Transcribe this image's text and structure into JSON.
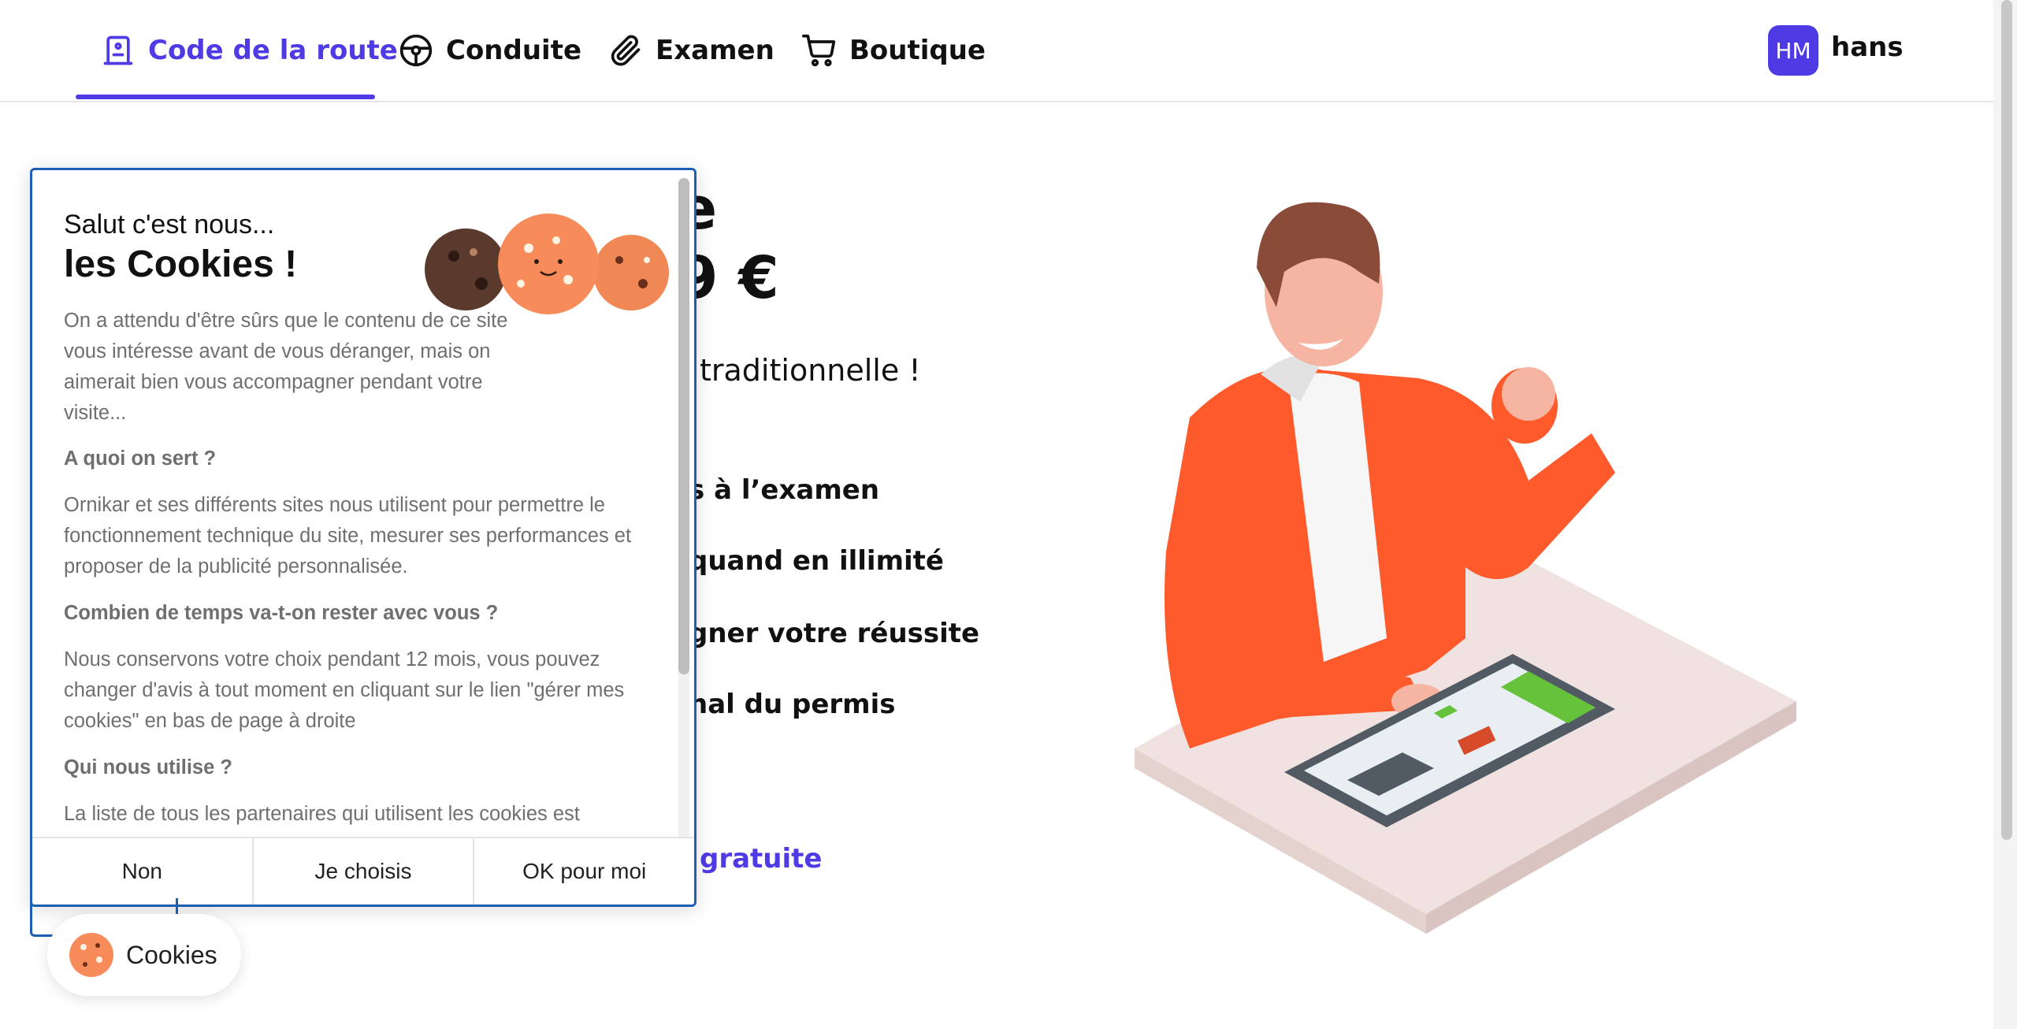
{
  "nav": {
    "items": [
      {
        "label": "Code de la route",
        "icon": "exam-board-icon",
        "active": true
      },
      {
        "label": "Conduite",
        "icon": "steering-wheel-icon",
        "active": false
      },
      {
        "label": "Examen",
        "icon": "paperclip-icon",
        "active": false
      },
      {
        "label": "Boutique",
        "icon": "cart-icon",
        "active": false
      }
    ],
    "user": {
      "initials": "HM",
      "name": "hans"
    }
  },
  "hero": {
    "title_line1_visible": "e",
    "title_line2_visible": "9 €",
    "subtitle_visible": "traditionnelle !",
    "features_visible": [
      "s à l’examen",
      "quand en illimité",
      "gner votre réussite",
      "nal du permis"
    ],
    "cta_visible": "gratuite"
  },
  "cookie_banner": {
    "greeting": "Salut c'est nous...",
    "title": "les Cookies !",
    "intro": "On a attendu d'être sûrs que le contenu de ce site vous intéresse avant de vous déranger, mais on aimerait bien vous accompagner pendant votre visite...",
    "sections": [
      {
        "heading": "A quoi on sert ?",
        "text": "Ornikar et ses différents sites nous utilisent pour permettre le fonctionnement technique du site, mesurer ses performances et proposer de la publicité personnalisée."
      },
      {
        "heading": "Combien de temps va-t-on rester avec vous ?",
        "text": "Nous conservons votre choix pendant 12 mois, vous pouvez changer d'avis à tout moment en cliquant sur le lien \"gérer mes cookies\" en bas de page à droite"
      },
      {
        "heading": "Qui nous utilise ?",
        "text": "La liste de tous les partenaires qui utilisent les cookies est"
      }
    ],
    "buttons": {
      "reject": "Non",
      "choose": "Je choisis",
      "accept": "OK pour moi"
    },
    "fab_label": "Cookies"
  },
  "colors": {
    "brand": "#4f3be3",
    "modal_border": "#1d5fb5",
    "jacket": "#ff5a2c"
  }
}
